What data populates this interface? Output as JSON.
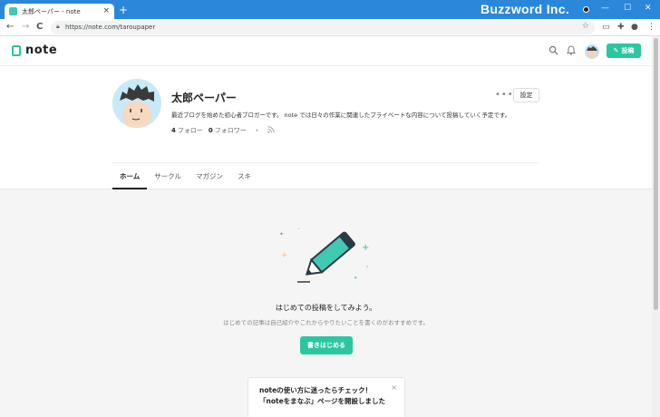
{
  "browser": {
    "tab_title": "太郎ペーパー - note",
    "tab_close": "×",
    "new_tab": "+",
    "brand": "Buzzword Inc.",
    "minimize": "—",
    "maximize": "☐",
    "close": "✕",
    "back": "←",
    "forward": "→",
    "reload": "C",
    "url": "https://note.com/taroupaper",
    "star": "☆",
    "menu": "⋮"
  },
  "header": {
    "logo": "note",
    "post_label": "投稿"
  },
  "profile": {
    "name": "太郎ペーパー",
    "more": "•••",
    "settings_label": "設定",
    "bio": "最近ブログを始めた初心者ブロガーです。 note では日々の作業に関連したプライベートな内容について投稿していく予定です。",
    "follow_count": "4",
    "follow_label": "フォロー",
    "follower_count": "0",
    "follower_label": "フォロワー",
    "separator": "・"
  },
  "tabs": [
    {
      "label": "ホーム",
      "active": true
    },
    {
      "label": "サークル",
      "active": false
    },
    {
      "label": "マガジン",
      "active": false
    },
    {
      "label": "スキ",
      "active": false
    }
  ],
  "empty_state": {
    "title": "はじめての投稿をしてみよう。",
    "subtitle": "はじめての記事は自己紹介やこれからやりたいことを書くのがおすすめです。",
    "button_label": "書きはじめる"
  },
  "card": {
    "text": "noteの使い方に迷ったらチェック！「noteをまなぶ」ページを開設しました",
    "close": "×"
  },
  "colors": {
    "accent": "#2cc6a1",
    "chrome": "#2b87d9"
  }
}
